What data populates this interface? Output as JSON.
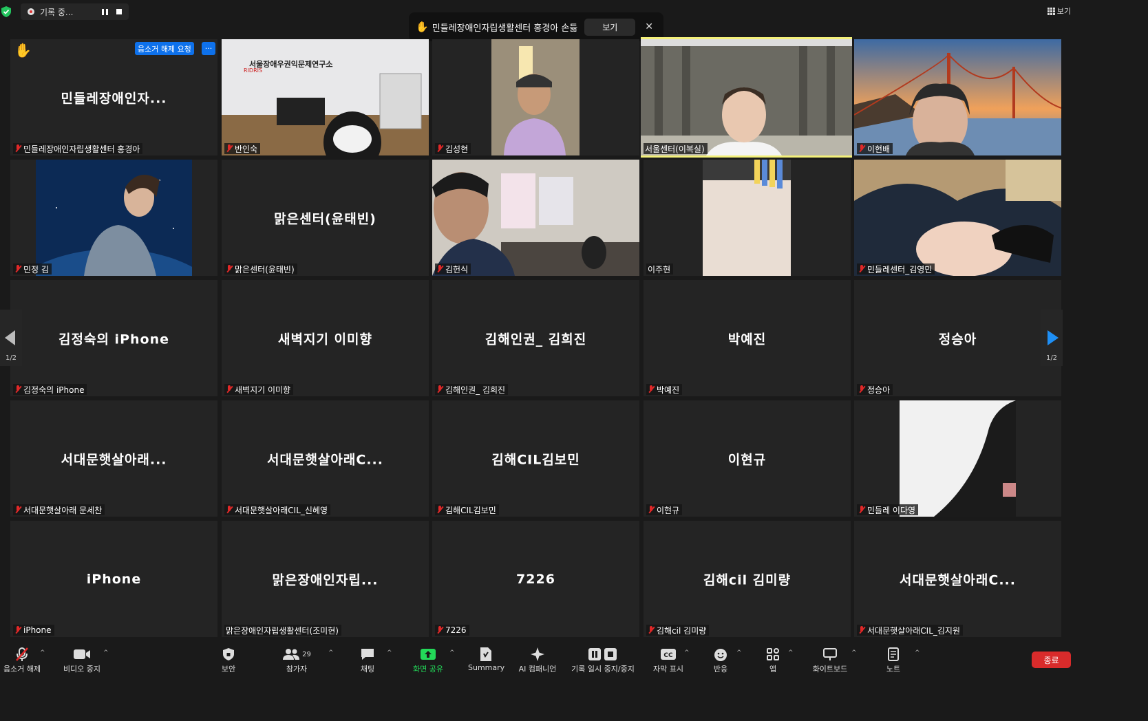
{
  "top_bar": {
    "recording_label": "기록 중...",
    "view_label": "보기"
  },
  "notification": {
    "message": "민들레장애인자립생활센터 홍경아 손듦",
    "view_button": "보기"
  },
  "first_tile": {
    "unmute_request": "음소거 해제 요청",
    "more": "···"
  },
  "participants": [
    {
      "big": "민들레장애인자...",
      "label": "민들레장애인자립생활센터 홍경아"
    },
    {
      "big": "",
      "label": "반인숙"
    },
    {
      "big": "",
      "label": "김성현"
    },
    {
      "big": "",
      "label": "서울센터(이복실)"
    },
    {
      "big": "",
      "label": "이현배"
    },
    {
      "big": "",
      "label": "민정 김"
    },
    {
      "big": "맑은센터(윤태빈)",
      "label": "맑은센터(윤태빈)"
    },
    {
      "big": "",
      "label": "김헌식"
    },
    {
      "big": "",
      "label": "이주현"
    },
    {
      "big": "",
      "label": "민들레센터_김영민"
    },
    {
      "big": "김정숙의 iPhone",
      "label": "김정숙의 iPhone"
    },
    {
      "big": "새벽지기 이미향",
      "label": "새벽지기 이미향"
    },
    {
      "big": "김해인권_ 김희진",
      "label": "김해인권_ 김희진"
    },
    {
      "big": "박예진",
      "label": "박예진"
    },
    {
      "big": "정승아",
      "label": "정승아"
    },
    {
      "big": "서대문햇살아래...",
      "label": "서대문햇살아래 문세찬"
    },
    {
      "big": "서대문햇살아래C...",
      "label": "서대문햇살아래CIL_신혜영"
    },
    {
      "big": "김해CIL김보민",
      "label": "김해CIL김보민"
    },
    {
      "big": "이현규",
      "label": "이현규"
    },
    {
      "big": "",
      "label": "민들레 이다영"
    },
    {
      "big": "iPhone",
      "label": "iPhone"
    },
    {
      "big": "맑은장애인자립...",
      "label": "맑은장애인자립생활센터(조미현)"
    },
    {
      "big": "7226",
      "label": "7226"
    },
    {
      "big": "김해cil 김미량",
      "label": "김해cil 김미량"
    },
    {
      "big": "서대문햇살아래C...",
      "label": "서대문햇살아래CIL_김지원"
    }
  ],
  "video_content": {
    "office_sign": "서울장애우권익문제연구소",
    "office_logo": "RIDRIS"
  },
  "paging": {
    "left": "1/2",
    "right": "1/2"
  },
  "toolbar": {
    "mute": "음소거 해제",
    "video": "비디오 중지",
    "security": "보안",
    "participants": "참가자",
    "participants_count": "29",
    "chat": "채팅",
    "share": "화면 공유",
    "summary": "Summary",
    "ai": "AI 컴패니언",
    "record": "기록 일시 중지/중지",
    "captions": "자막 표시",
    "reactions": "반응",
    "apps": "앱",
    "whiteboard": "화이트보드",
    "notes": "노트",
    "end": "종료"
  },
  "colors": {
    "share_green": "#23d959",
    "end_red": "#d92b2b",
    "active_speaker": "#f3f07a",
    "accent_blue": "#0e71eb"
  }
}
